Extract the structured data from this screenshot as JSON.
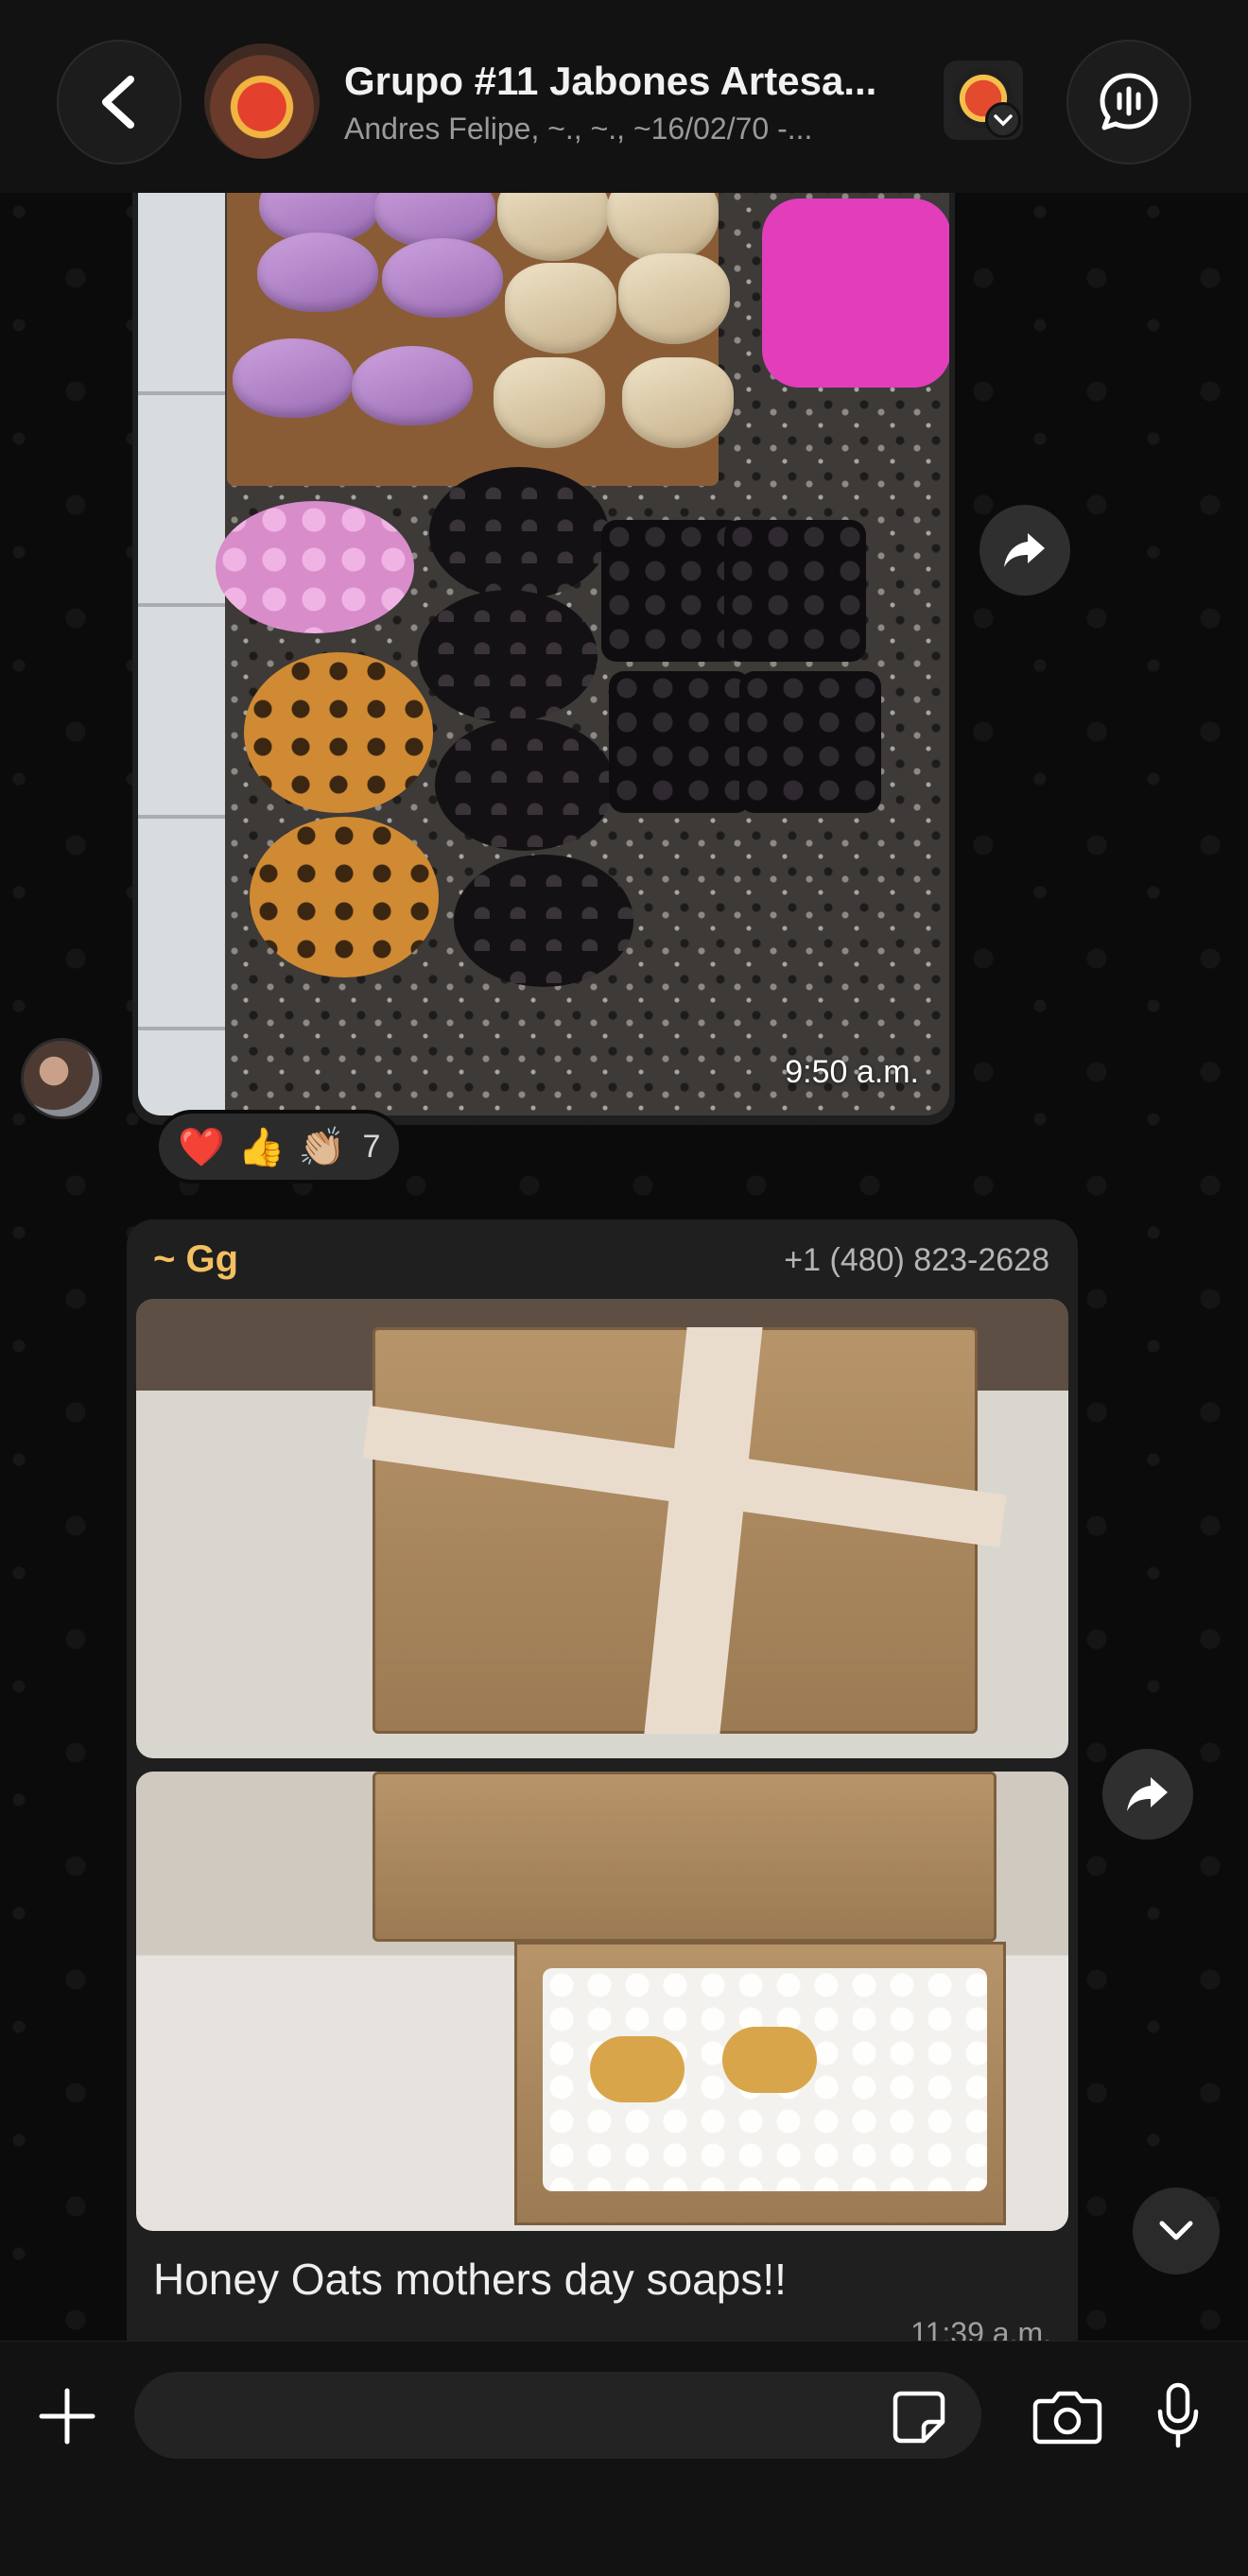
{
  "header": {
    "title": "Grupo #11 Jabones Artesa...",
    "subtitle": "Andres Felipe, ~., ~., ~16/02/70 -..."
  },
  "messages": [
    {
      "type": "image",
      "time": "9:50 a.m.",
      "reactions": {
        "emojis": [
          "❤️",
          "👍",
          "👏🏼"
        ],
        "count": "7"
      }
    },
    {
      "type": "album",
      "author": "~ Gg",
      "phone": "+1 (480) 823-2628",
      "caption": "Honey Oats mothers day soaps!!",
      "time": "11:39 a.m."
    }
  ],
  "composer": {
    "placeholder": ""
  },
  "icons": {
    "back": "chevron-left-icon",
    "call": "voice-chat-icon",
    "forward": "forward-icon",
    "scroll": "chevron-down-icon",
    "plus": "plus-icon",
    "sticker": "sticker-icon",
    "camera": "camera-icon",
    "mic": "microphone-icon"
  },
  "colors": {
    "background": "#0b0b0b",
    "bubble": "#1f1f1f",
    "author": "#f3c061"
  }
}
